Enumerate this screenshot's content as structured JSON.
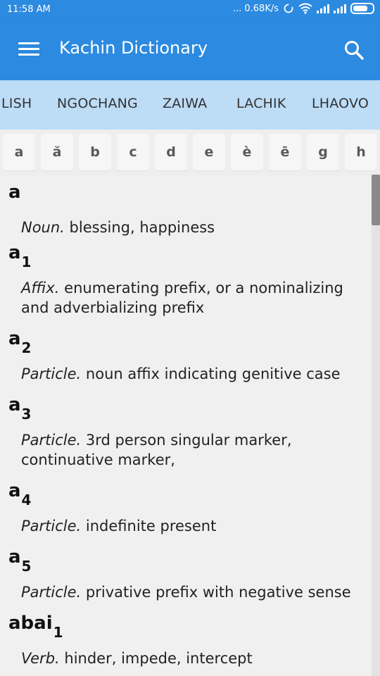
{
  "status_bar": {
    "time": "11:58 AM",
    "speed": "... 0.68K/s"
  },
  "app_bar": {
    "title": "Kachin Dictionary",
    "menu_icon": "hamburger-menu-icon",
    "search_icon": "search-icon"
  },
  "tabs": [
    "LISH",
    "NGOCHANG",
    "ZAIWA",
    "LACHIK",
    "LHAOVO"
  ],
  "letters": [
    "a",
    "ă",
    "b",
    "c",
    "d",
    "e",
    "è",
    "ē",
    "g",
    "h"
  ],
  "entries": [
    {
      "word": "a",
      "sub": "",
      "pos": "Noun.",
      "definition": "blessing, happiness"
    },
    {
      "word": "a",
      "sub": "1",
      "pos": "Affix.",
      "definition": "enumerating prefix, or a nominalizing and adverbializing prefix"
    },
    {
      "word": "a",
      "sub": "2",
      "pos": "Particle.",
      "definition": "noun affix indicating genitive case"
    },
    {
      "word": "a",
      "sub": "3",
      "pos": "Particle.",
      "definition": "3rd person singular marker, continuative marker,"
    },
    {
      "word": "a",
      "sub": "4",
      "pos": "Particle.",
      "definition": "indefinite present"
    },
    {
      "word": "a",
      "sub": "5",
      "pos": "Particle.",
      "definition": "privative prefix with negative sense"
    },
    {
      "word": "abai",
      "sub": "1",
      "pos": "Verb.",
      "definition": "hinder, impede, intercept"
    }
  ],
  "colors": {
    "primary": "#2c8ae0",
    "tab_bar": "#bddcf6",
    "background": "#f0f0f0"
  }
}
